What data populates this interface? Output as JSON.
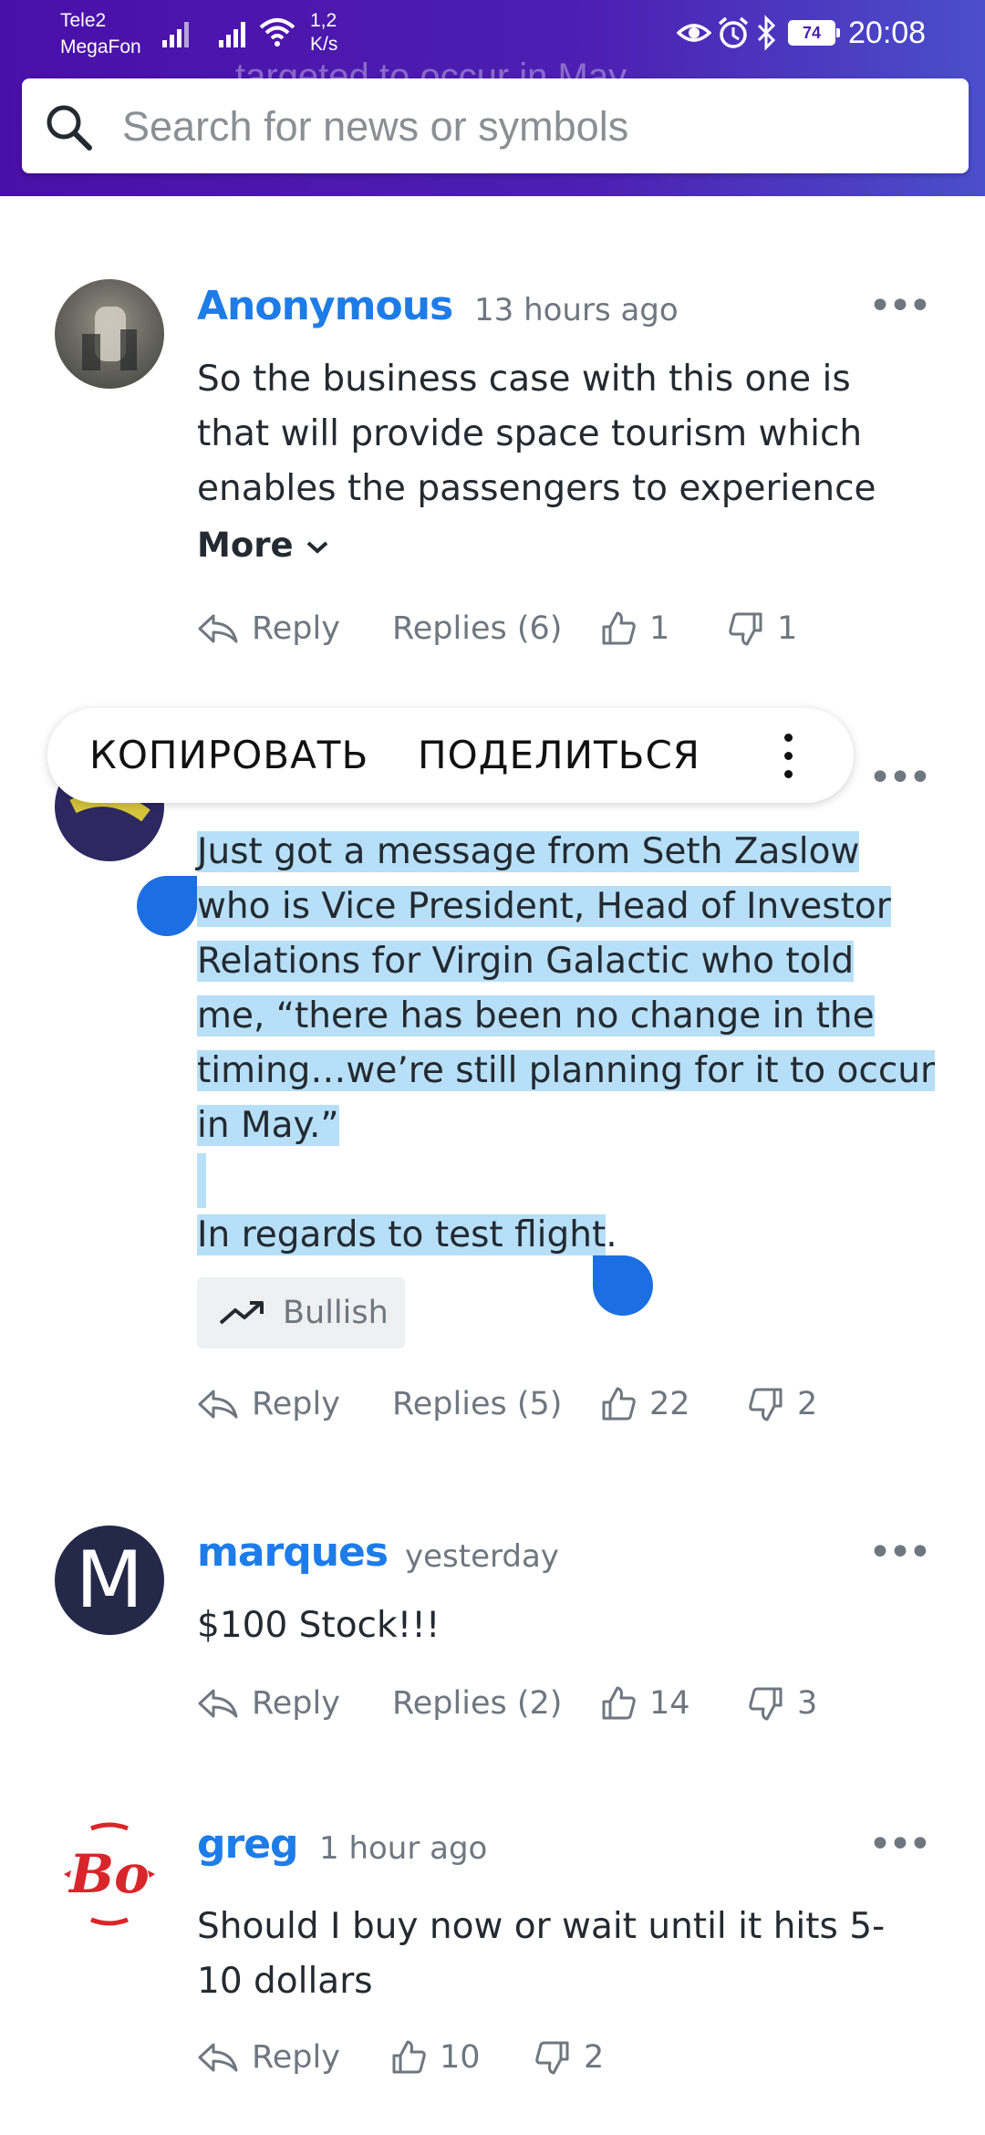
{
  "status_bar": {
    "carrier1": "Tele2",
    "carrier2": "MegaFon",
    "net_speed_value": "1,2",
    "net_speed_unit": "K/s",
    "battery": "74",
    "time": "20:08",
    "icons": [
      "signal-icon",
      "signal-icon",
      "wifi-icon",
      "eye-icon",
      "alarm-icon",
      "bluetooth-icon",
      "battery-icon"
    ]
  },
  "header": {
    "ghost_text": "targeted to occur in May",
    "search_placeholder": "Search for news or symbols"
  },
  "selection_popup": {
    "copy": "КОПИРОВАТЬ",
    "share": "ПОДЕЛИТЬСЯ"
  },
  "comments": [
    {
      "username": "Anonymous",
      "time": "13 hours ago",
      "body": "So the business case with this one is that will provide space tourism which enables the passengers to experience",
      "more": "More",
      "reply": "Reply",
      "replies": "Replies (6)",
      "likes": "1",
      "dislikes": "1"
    },
    {
      "username": "",
      "time": "",
      "body_lines": [
        "Just got a message from Seth Zaslow",
        "who is Vice President, Head of Investor",
        "Relations for Virgin Galactic who told",
        "me, “there has been no change in the",
        "timing…we’re still planning for it to occur",
        "in May.”",
        "",
        "In regards to test flight",
        "."
      ],
      "sentiment": "Bullish",
      "reply": "Reply",
      "replies": "Replies (5)",
      "likes": "22",
      "dislikes": "2"
    },
    {
      "username": "marques",
      "avatar_letter": "M",
      "time": "yesterday",
      "body": "$100 Stock!!!",
      "reply": "Reply",
      "replies": "Replies (2)",
      "likes": "14",
      "dislikes": "3"
    },
    {
      "username": "greg",
      "avatar_text": "Bo",
      "time": "1 hour ago",
      "body": "Should I buy now or wait until it hits 5-10 dollars",
      "reply": "Reply",
      "likes": "10",
      "dislikes": "2"
    }
  ],
  "colors": {
    "header_gradient_start": "#4a0fa8",
    "header_gradient_end": "#4a4fcc",
    "username": "#1d7ce8",
    "selection": "#b7dff7",
    "selection_handle": "#1b6fe3"
  }
}
